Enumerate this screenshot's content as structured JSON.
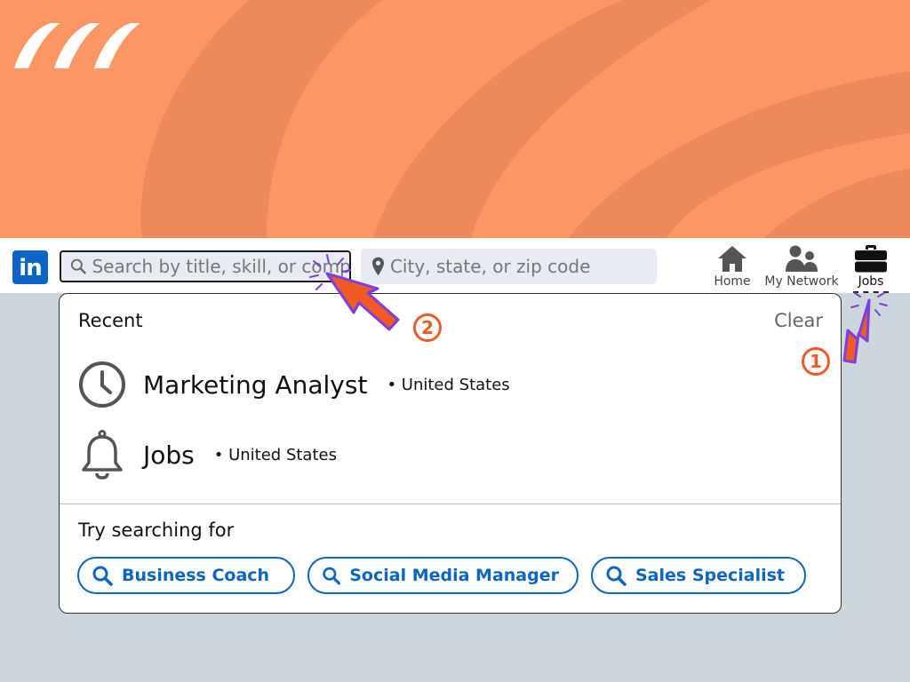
{
  "navbar": {
    "logo_text": "in",
    "search": {
      "placeholder": "Search by title, skill, or company",
      "value": ""
    },
    "location": {
      "placeholder": "City, state, or zip code",
      "value": ""
    },
    "nav_items": [
      {
        "label": "Home",
        "icon": "home-icon"
      },
      {
        "label": "My Network",
        "icon": "people-icon"
      },
      {
        "label": "Jobs",
        "icon": "briefcase-icon",
        "active": true
      }
    ]
  },
  "dropdown": {
    "recent_title": "Recent",
    "clear_label": "Clear",
    "recent_items": [
      {
        "title": "Marketing Analyst",
        "location": "• United States",
        "icon": "clock-icon"
      },
      {
        "title": "Jobs",
        "location": "• United States",
        "icon": "bell-icon"
      }
    ],
    "try_title": "Try searching for",
    "suggestions": [
      {
        "label": "Business Coach"
      },
      {
        "label": "Social Media Manager"
      },
      {
        "label": "Sales Specialist"
      }
    ]
  },
  "annotations": {
    "step1": "1",
    "step2": "2"
  },
  "colors": {
    "banner": "#fe9663",
    "banner_wave": "#ec8a5b",
    "brand_blue": "#0a66c2",
    "annotation_orange": "#f15a24",
    "annotation_purple": "#7b3fe4",
    "page_background": "#cdd6dd"
  }
}
